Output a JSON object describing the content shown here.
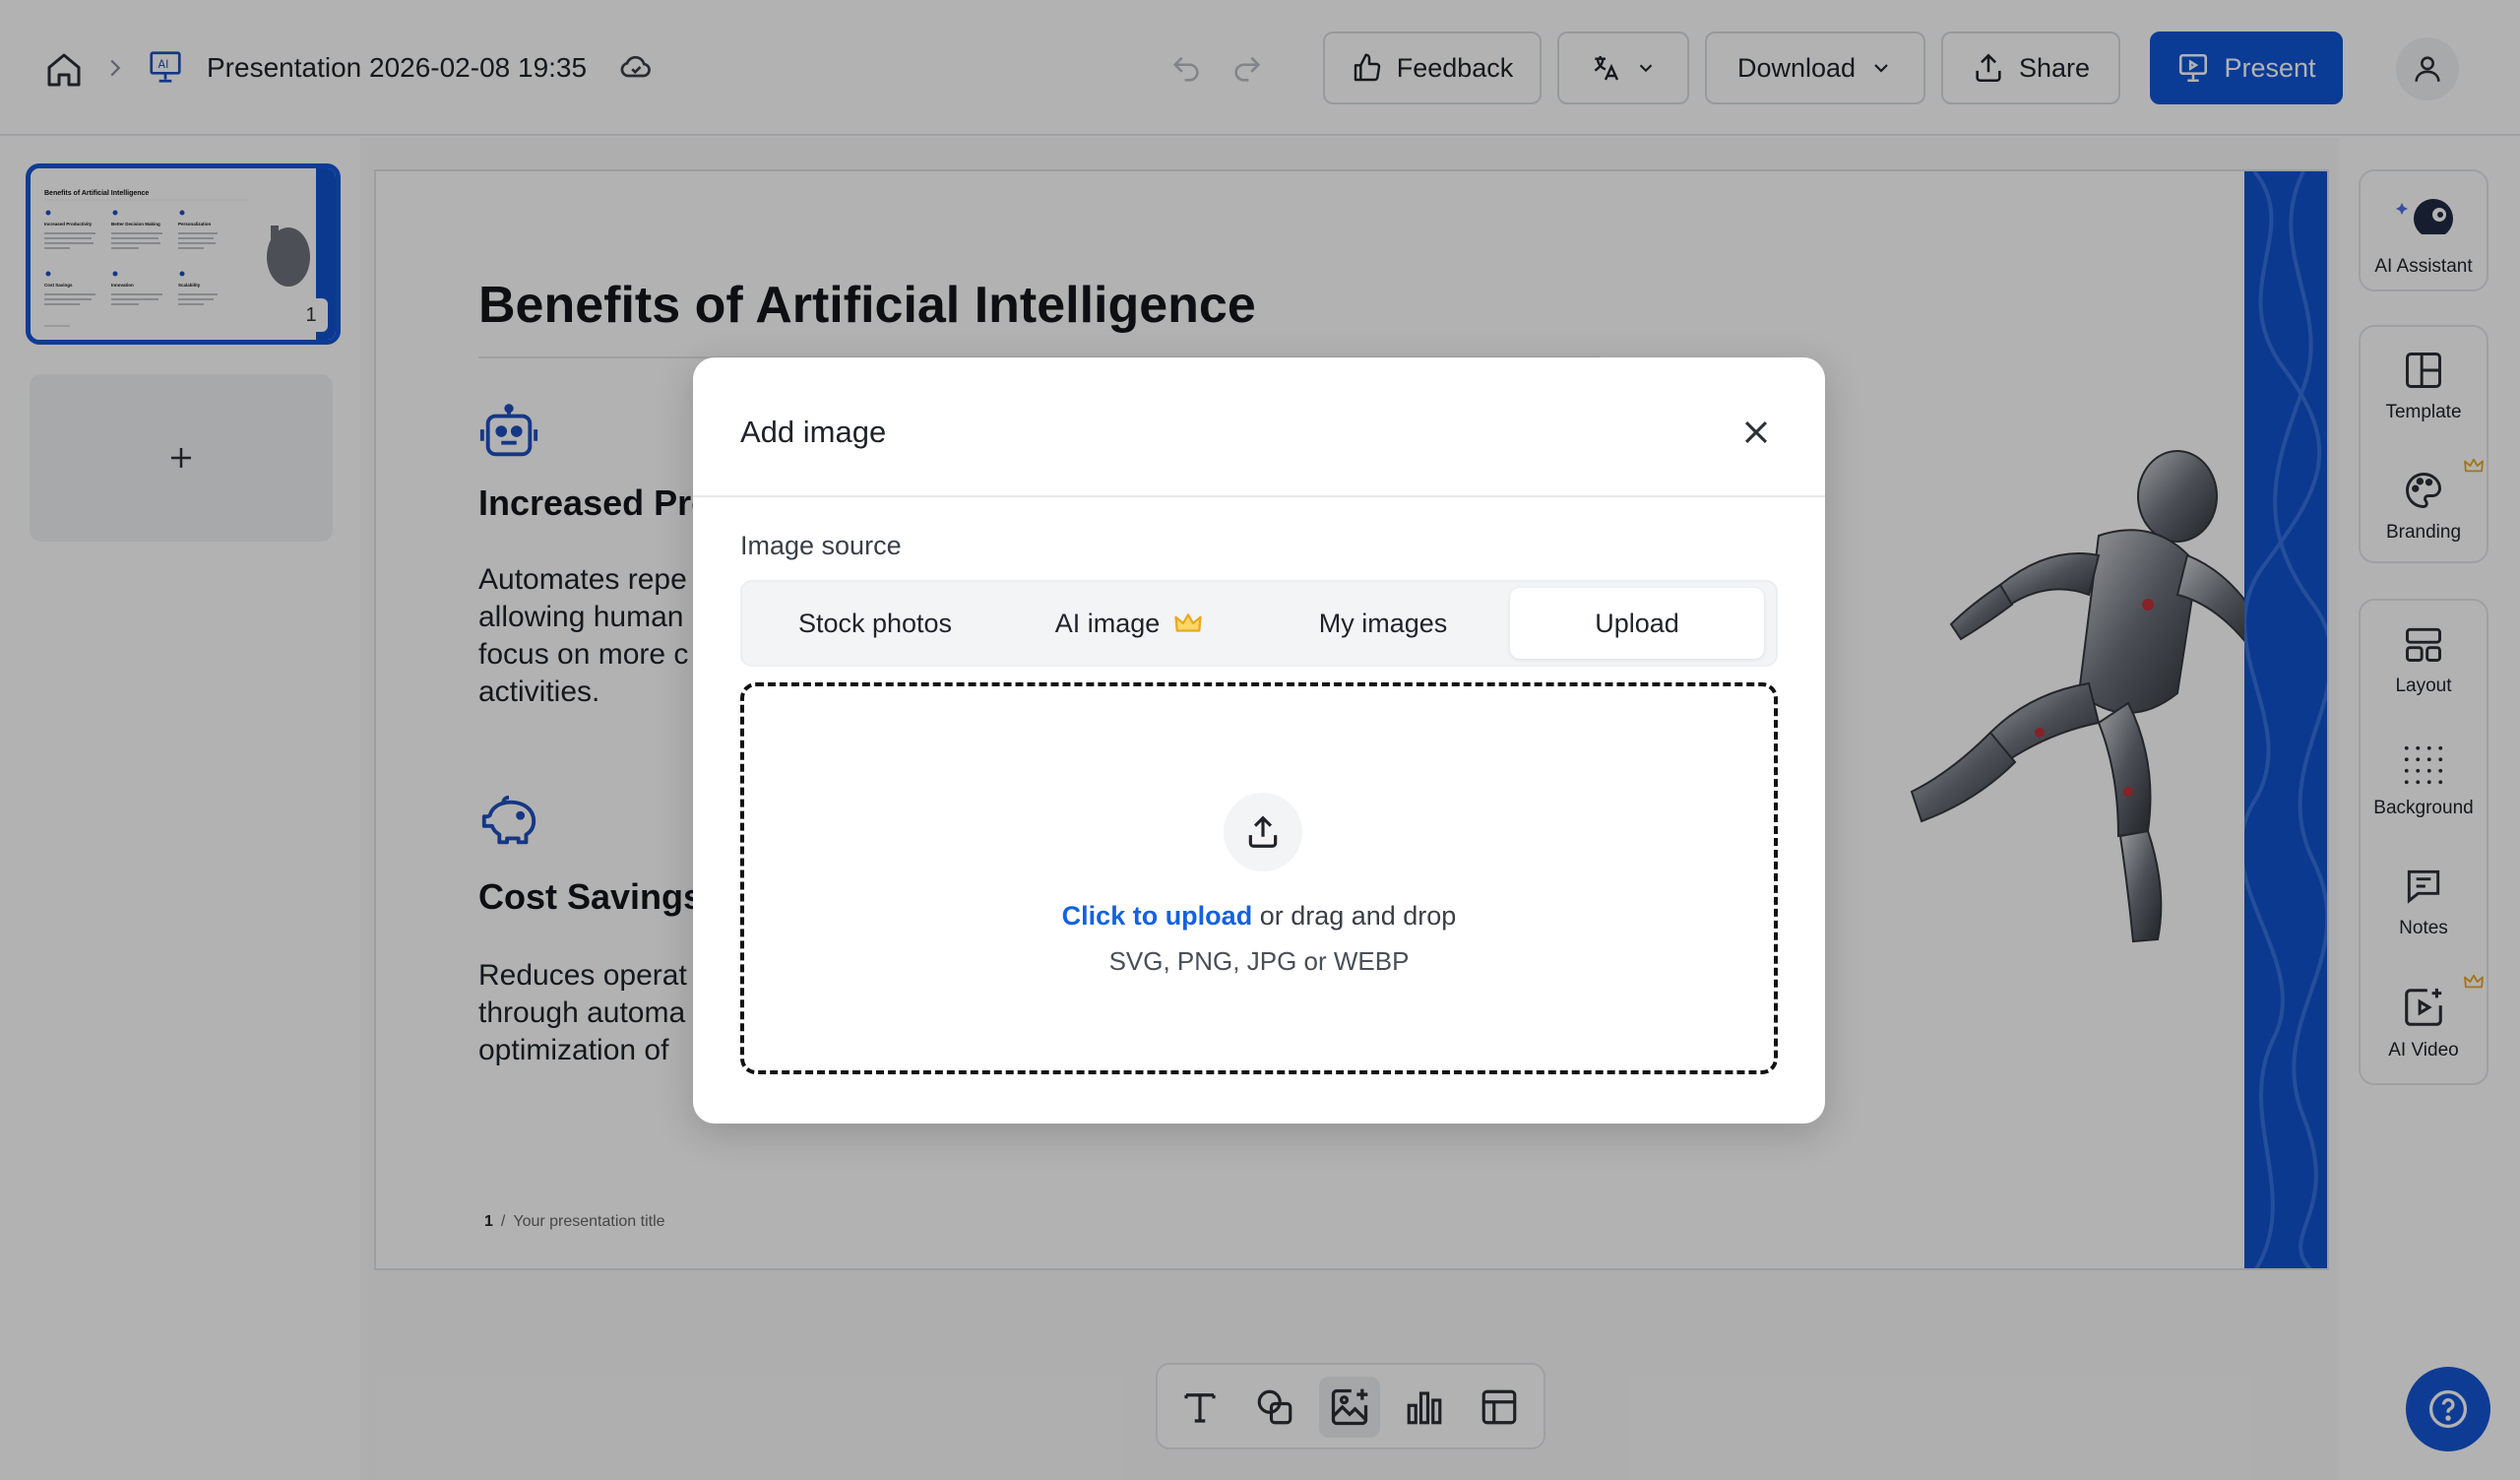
{
  "header": {
    "document_title": "Presentation 2026-02-08 19:35",
    "feedback_label": "Feedback",
    "download_label": "Download",
    "share_label": "Share",
    "present_label": "Present"
  },
  "slides_panel": {
    "thumbnails": [
      {
        "number": "1",
        "title": "Benefits of Artificial Intelligence"
      }
    ],
    "add_label": "+"
  },
  "slide": {
    "title": "Benefits of Artificial Intelligence",
    "features": [
      {
        "title": "Increased Pro",
        "body": "Automates repe allowing human focus on more c activities."
      },
      {
        "title": "Cost Savings",
        "body": "Reduces operat through automa optimization of"
      }
    ],
    "footer_page": "1",
    "footer_sep": "/",
    "footer_text": "Your presentation title"
  },
  "thumbnail_features": [
    "Increased Productivity",
    "Better Decision Making",
    "Personalization",
    "Cost Savings",
    "Innovation",
    "Scalability"
  ],
  "right_rail": {
    "ai_assistant": "AI Assistant",
    "template": "Template",
    "branding": "Branding",
    "layout": "Layout",
    "background": "Background",
    "notes": "Notes",
    "ai_video": "AI Video"
  },
  "bottom_toolbar": {
    "tools": [
      "text-tool-icon",
      "shapes-tool-icon",
      "add-image-tool-icon",
      "chart-tool-icon",
      "table-tool-icon"
    ]
  },
  "modal": {
    "title": "Add image",
    "source_label": "Image source",
    "tabs": [
      {
        "label": "Stock photos",
        "active": false
      },
      {
        "label": "AI image",
        "active": false,
        "premium": true
      },
      {
        "label": "My images",
        "active": false
      },
      {
        "label": "Upload",
        "active": true
      }
    ],
    "dropzone": {
      "link_text": "Click to upload",
      "rest_text": " or drag and drop",
      "formats": "SVG, PNG, JPG or WEBP"
    }
  },
  "colors": {
    "accent": "#0f55d6",
    "link": "#1561e0",
    "premium_crown": "#e8a91e",
    "slide_strip": "#1252cf"
  }
}
